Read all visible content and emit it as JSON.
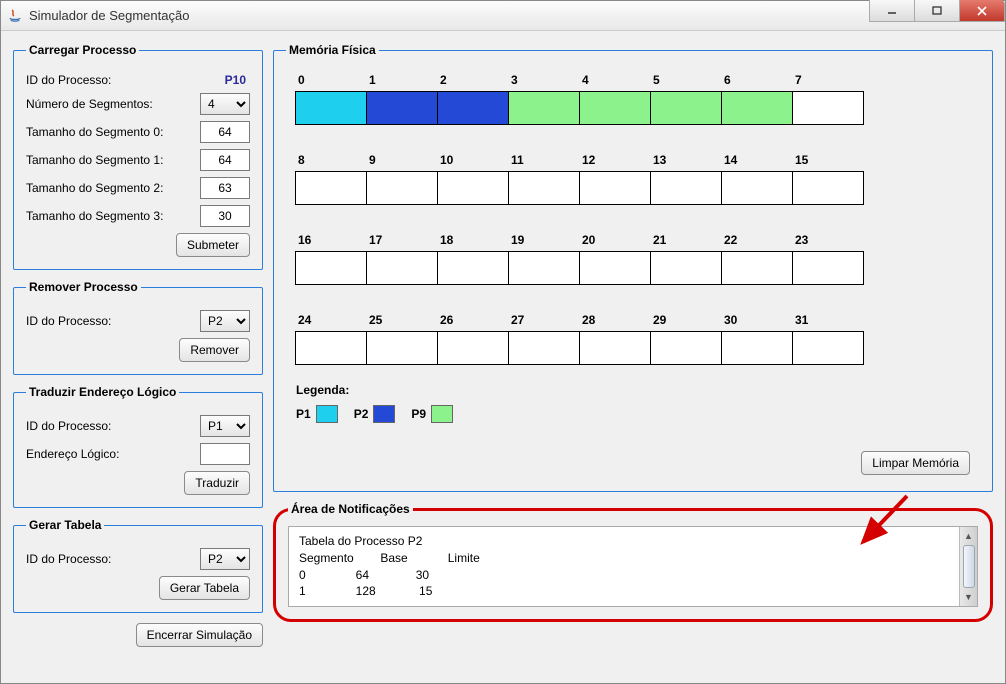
{
  "window": {
    "title": "Simulador de Segmentação"
  },
  "carregar": {
    "legend": "Carregar Processo",
    "id_label": "ID do Processo:",
    "id_value": "P10",
    "num_seg_label": "Número de Segmentos:",
    "num_seg_value": "4",
    "seg_label_0": "Tamanho do Segmento 0:",
    "seg_val_0": "64",
    "seg_label_1": "Tamanho do Segmento 1:",
    "seg_val_1": "64",
    "seg_label_2": "Tamanho do Segmento 2:",
    "seg_val_2": "63",
    "seg_label_3": "Tamanho do Segmento 3:",
    "seg_val_3": "30",
    "submit_label": "Submeter"
  },
  "remover": {
    "legend": "Remover Processo",
    "id_label": "ID do Processo:",
    "id_value": "P2",
    "btn_label": "Remover"
  },
  "traduzir": {
    "legend": "Traduzir Endereço Lógico",
    "id_label": "ID do Processo:",
    "id_value": "P1",
    "endereco_label": "Endereço Lógico:",
    "endereco_value": "",
    "btn_label": "Traduzir"
  },
  "gerar": {
    "legend": "Gerar Tabela",
    "id_label": "ID do Processo:",
    "id_value": "P2",
    "btn_label": "Gerar Tabela"
  },
  "encerrar_label": "Encerrar Simulação",
  "memoria": {
    "legend": "Memória Física",
    "cells": [
      {
        "idx": "0",
        "color": "#1ecfee"
      },
      {
        "idx": "1",
        "color": "#2349d6"
      },
      {
        "idx": "2",
        "color": "#2349d6"
      },
      {
        "idx": "3",
        "color": "#8cf28c"
      },
      {
        "idx": "4",
        "color": "#8cf28c"
      },
      {
        "idx": "5",
        "color": "#8cf28c"
      },
      {
        "idx": "6",
        "color": "#8cf28c"
      },
      {
        "idx": "7",
        "color": "#ffffff"
      },
      {
        "idx": "8",
        "color": "#ffffff"
      },
      {
        "idx": "9",
        "color": "#ffffff"
      },
      {
        "idx": "10",
        "color": "#ffffff"
      },
      {
        "idx": "11",
        "color": "#ffffff"
      },
      {
        "idx": "12",
        "color": "#ffffff"
      },
      {
        "idx": "13",
        "color": "#ffffff"
      },
      {
        "idx": "14",
        "color": "#ffffff"
      },
      {
        "idx": "15",
        "color": "#ffffff"
      },
      {
        "idx": "16",
        "color": "#ffffff"
      },
      {
        "idx": "17",
        "color": "#ffffff"
      },
      {
        "idx": "18",
        "color": "#ffffff"
      },
      {
        "idx": "19",
        "color": "#ffffff"
      },
      {
        "idx": "20",
        "color": "#ffffff"
      },
      {
        "idx": "21",
        "color": "#ffffff"
      },
      {
        "idx": "22",
        "color": "#ffffff"
      },
      {
        "idx": "23",
        "color": "#ffffff"
      },
      {
        "idx": "24",
        "color": "#ffffff"
      },
      {
        "idx": "25",
        "color": "#ffffff"
      },
      {
        "idx": "26",
        "color": "#ffffff"
      },
      {
        "idx": "27",
        "color": "#ffffff"
      },
      {
        "idx": "28",
        "color": "#ffffff"
      },
      {
        "idx": "29",
        "color": "#ffffff"
      },
      {
        "idx": "30",
        "color": "#ffffff"
      },
      {
        "idx": "31",
        "color": "#ffffff"
      }
    ],
    "legenda_title": "Legenda:",
    "legenda": [
      {
        "label": "P1",
        "color": "#1ecfee"
      },
      {
        "label": "P2",
        "color": "#2349d6"
      },
      {
        "label": "P9",
        "color": "#8cf28c"
      }
    ],
    "limpar_label": "Limpar Memória"
  },
  "notificacoes": {
    "legend": "Área de Notificações",
    "text": "Tabela do Processo P2\nSegmento        Base            Limite\n0               64              30\n1               128             15"
  }
}
